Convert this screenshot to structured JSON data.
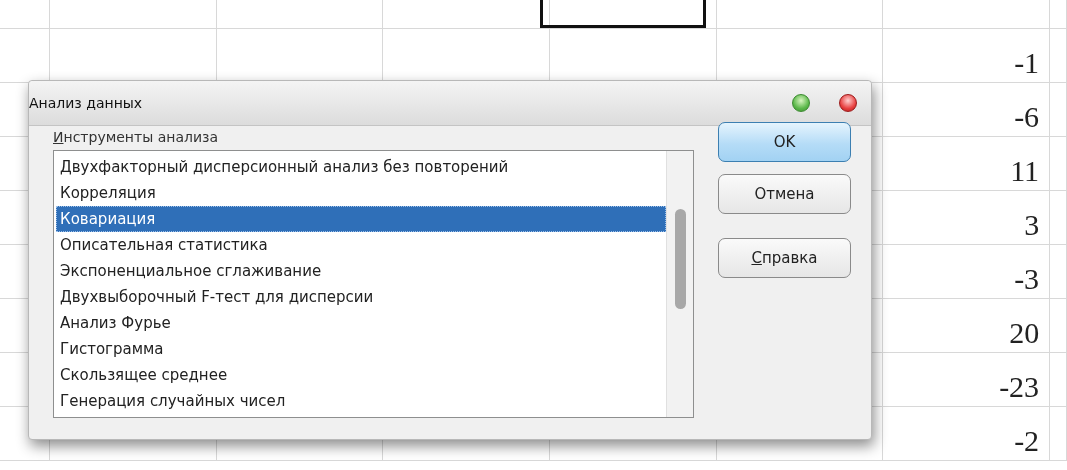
{
  "sheet": {
    "visible_values": [
      "-1",
      "-6",
      "11",
      "3",
      "-3",
      "20",
      "-23",
      "-2"
    ]
  },
  "dialog": {
    "title": "Анализ данных",
    "list_label": {
      "text": "Инструменты анализа",
      "access_key_underlined": true
    },
    "tools": [
      {
        "label": "Двухфакторный дисперсионный анализ без повторений",
        "selected": false
      },
      {
        "label": "Корреляция",
        "selected": false
      },
      {
        "label": "Ковариация",
        "selected": true
      },
      {
        "label": "Описательная статистика",
        "selected": false
      },
      {
        "label": "Экспоненциальное сглаживание",
        "selected": false
      },
      {
        "label": "Двухвыборочный F-тест для дисперсии",
        "selected": false
      },
      {
        "label": "Анализ Фурье",
        "selected": false
      },
      {
        "label": "Гистограмма",
        "selected": false
      },
      {
        "label": "Скользящее среднее",
        "selected": false
      },
      {
        "label": "Генерация случайных чисел",
        "selected": false
      }
    ],
    "buttons": [
      {
        "label": "OK",
        "kind": "default",
        "access_key_underlined": false
      },
      {
        "label": "Отмена",
        "kind": "normal",
        "access_key_underlined": false
      },
      {
        "label": "Справка",
        "kind": "spaced",
        "access_key_underlined": true
      }
    ]
  }
}
